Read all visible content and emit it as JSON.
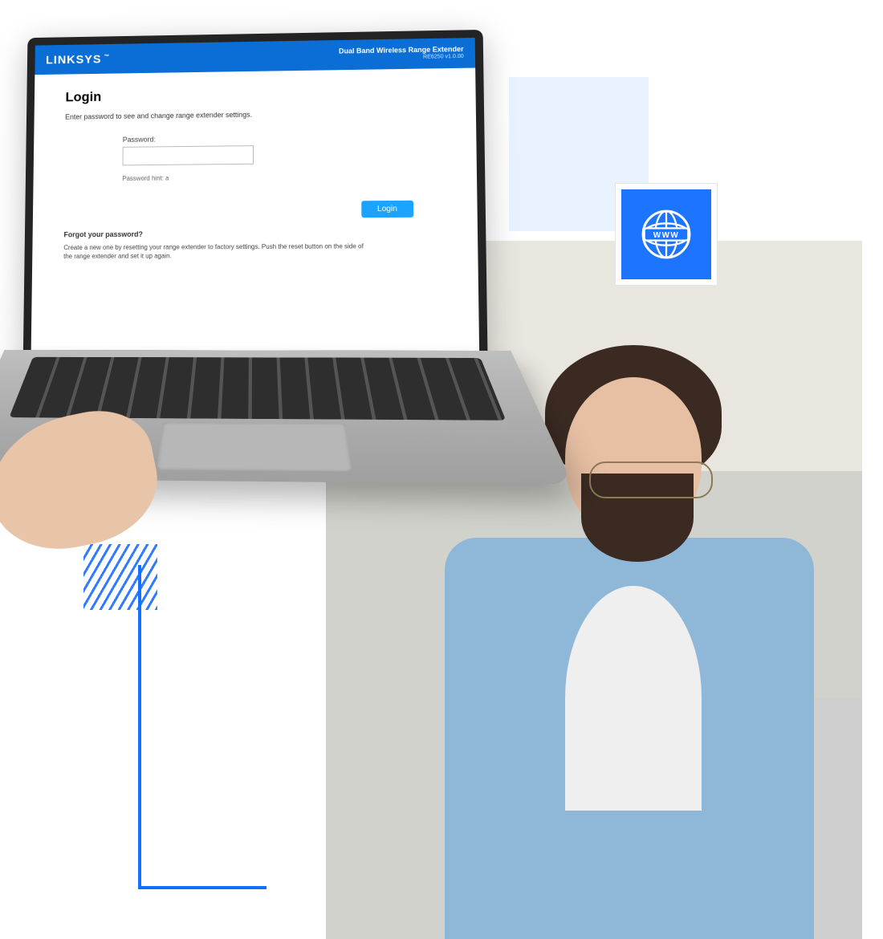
{
  "header": {
    "brand": "LINKSYS",
    "product": "Dual Band Wireless Range Extender",
    "version": "RE6250 v1.0.00"
  },
  "login": {
    "title": "Login",
    "intro": "Enter password to see and change range extender settings.",
    "password_label": "Password:",
    "password_value": "",
    "password_hint_label": "Password hint:",
    "password_hint_value": "a",
    "login_button": "Login",
    "forgot_heading": "Forgot your password?",
    "reset_instructions": "Create a new one by resetting your range extender to factory settings. Push the reset button on the side of the range extender and set it up again."
  },
  "badge": {
    "label": "WWW",
    "icon": "globe-www-icon",
    "accent": "#1d74ff"
  }
}
